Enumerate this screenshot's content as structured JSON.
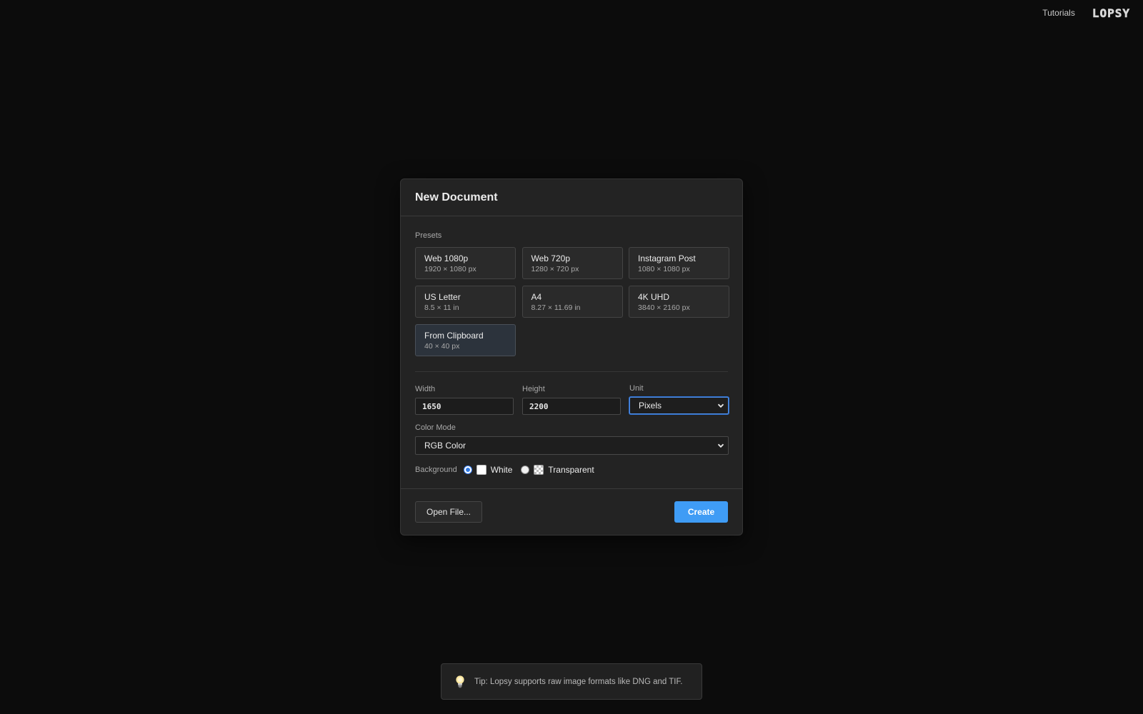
{
  "topbar": {
    "tutorials_label": "Tutorials",
    "logo_text": "LOPSY"
  },
  "dialog": {
    "title": "New Document",
    "presets_label": "Presets",
    "presets": [
      {
        "name": "Web 1080p",
        "dims": "1920 × 1080 px"
      },
      {
        "name": "Web 720p",
        "dims": "1280 × 720 px"
      },
      {
        "name": "Instagram Post",
        "dims": "1080 × 1080 px"
      },
      {
        "name": "US Letter",
        "dims": "8.5 × 11 in"
      },
      {
        "name": "A4",
        "dims": "8.27 × 11.69 in"
      },
      {
        "name": "4K UHD",
        "dims": "3840 × 2160 px"
      },
      {
        "name": "From Clipboard",
        "dims": "40 × 40 px"
      }
    ],
    "width_label": "Width",
    "width_value": "1650",
    "height_label": "Height",
    "height_value": "2200",
    "unit_label": "Unit",
    "unit_value": "Pixels",
    "color_mode_label": "Color Mode",
    "color_mode_value": "RGB Color",
    "background_label": "Background",
    "background_options": [
      "White",
      "Transparent"
    ],
    "background_selected": "White",
    "open_file_label": "Open File...",
    "create_label": "Create"
  },
  "toast": {
    "tip_text": "Tip: Lopsy supports raw image formats like DNG and TIF."
  },
  "colors": {
    "accent": "#3f9cf5",
    "focus": "#4f8ce0",
    "background": "#0c0c0c",
    "dialog": "#232323"
  },
  "icons": {
    "dropdown": "chevron-down-icon",
    "tip": "lightbulb-icon"
  }
}
